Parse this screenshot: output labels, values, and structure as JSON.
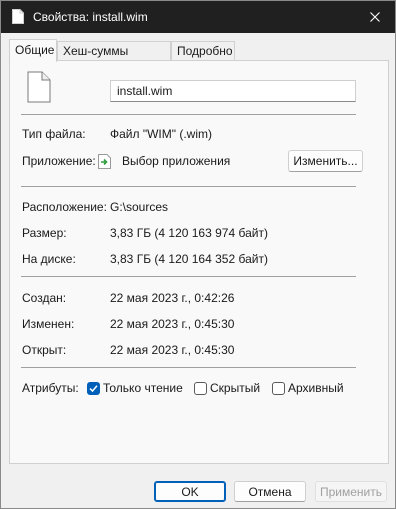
{
  "window": {
    "title": "Свойства: install.wim",
    "close_icon": "close-icon"
  },
  "tabs": [
    {
      "label": "Общие",
      "active": true
    },
    {
      "label": "Хеш-суммы файлов",
      "active": false
    },
    {
      "label": "Подробно",
      "active": false
    }
  ],
  "general": {
    "file_name": "install.wim",
    "file_type_label": "Тип файла:",
    "file_type_value": "Файл \"WIM\" (.wim)",
    "app_label": "Приложение:",
    "app_value": "Выбор приложения",
    "change_button": "Изменить...",
    "location_label": "Расположение:",
    "location_value": "G:\\sources",
    "size_label": "Размер:",
    "size_value": "3,83 ГБ (4 120 163 974 байт)",
    "disk_label": "На диске:",
    "disk_value": "3,83 ГБ (4 120 164 352 байт)",
    "created_label": "Создан:",
    "created_value": "22 мая 2023 г., 0:42:26",
    "modified_label": "Изменен:",
    "modified_value": "22 мая 2023 г., 0:45:30",
    "opened_label": "Открыт:",
    "opened_value": "22 мая 2023 г., 0:45:30",
    "attributes_label": "Атрибуты:",
    "attributes": [
      {
        "label": "Только чтение",
        "checked": true
      },
      {
        "label": "Скрытый",
        "checked": false
      },
      {
        "label": "Архивный",
        "checked": false
      }
    ]
  },
  "buttons": {
    "ok": "OK",
    "cancel": "Отмена",
    "apply": "Применить"
  },
  "colors": {
    "titlebar": "#202020",
    "accent": "#005fb8"
  }
}
